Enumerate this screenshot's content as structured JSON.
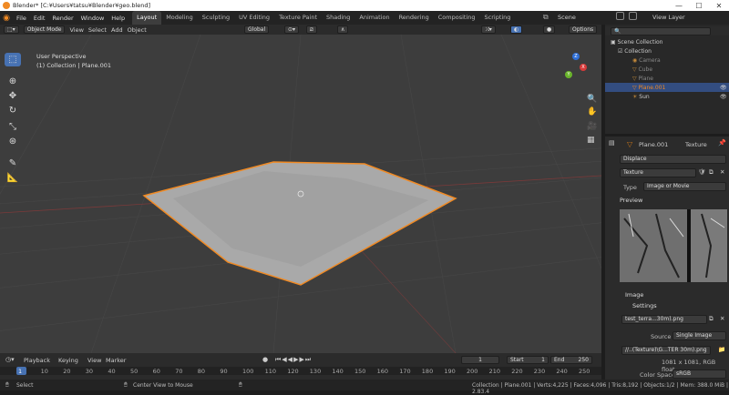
{
  "window": {
    "title": "Blender* [C:¥Users¥tatsu¥Blender¥geo.blend]",
    "min": "—",
    "max": "☐",
    "close": "✕"
  },
  "menus": [
    "File",
    "Edit",
    "Render",
    "Window",
    "Help"
  ],
  "workspaces": [
    "Layout",
    "Modeling",
    "Sculpting",
    "UV Editing",
    "Texture Paint",
    "Shading",
    "Animation",
    "Rendering",
    "Compositing",
    "Scripting"
  ],
  "scene": {
    "label": "Scene",
    "view_layer": "View Layer"
  },
  "viewport_header": {
    "mode": "Object Mode",
    "view": "View",
    "select": "Select",
    "add": "Add",
    "object": "Object",
    "orientation": "Global",
    "options": "Options"
  },
  "viewport": {
    "perspective": "User Perspective",
    "collection": "(1) Collection | Plane.001",
    "axis_x": "X",
    "axis_y": "Y",
    "axis_z": "Z"
  },
  "outliner": {
    "rows": [
      {
        "label": "Scene Collection"
      },
      {
        "label": "Collection"
      },
      {
        "label": "Camera"
      },
      {
        "label": "Cube"
      },
      {
        "label": "Plane"
      },
      {
        "label": "Plane.001"
      },
      {
        "label": "Sun"
      }
    ]
  },
  "properties": {
    "object": "Plane.001",
    "texture_label": "Texture",
    "modifier": "Displace",
    "texture_name": "Texture",
    "type_label": "Type",
    "type_value": "Image or Movie",
    "preview": "Preview",
    "image_panel": "Image",
    "settings": "Settings",
    "image_file": "test_terra...30m).png",
    "source_label": "Source",
    "source_value": "Single Image",
    "filepath": "//..(Texture)\\G...TER 30m).png",
    "resolution": "1081 x 1081,  RGB float",
    "color_space_label": "Color Space",
    "color_space_value": "sRGB"
  },
  "timeline": {
    "playback": "Playback",
    "keying": "Keying",
    "view": "View",
    "marker": "Marker",
    "current_frame": "1",
    "start_label": "Start",
    "start_value": "1",
    "end_label": "End",
    "end_value": "250",
    "ticks": [
      "1",
      "10",
      "20",
      "30",
      "40",
      "50",
      "60",
      "70",
      "80",
      "90",
      "100",
      "110",
      "120",
      "130",
      "140",
      "150",
      "160",
      "170",
      "180",
      "190",
      "200",
      "210",
      "220",
      "230",
      "240",
      "250"
    ]
  },
  "statusbar": {
    "select": "Select",
    "center": "Center View to Mouse",
    "stats": "Collection | Plane.001 | Verts:4,225 | Faces:4,096 | Tris:8,192 | Objects:1/2 | Mem: 388.0 MiB | 2.83.4"
  },
  "colors": {
    "accent": "#4772b3",
    "selected_outline": "#f08a24",
    "viewport_bg": "#3d3d3d"
  }
}
